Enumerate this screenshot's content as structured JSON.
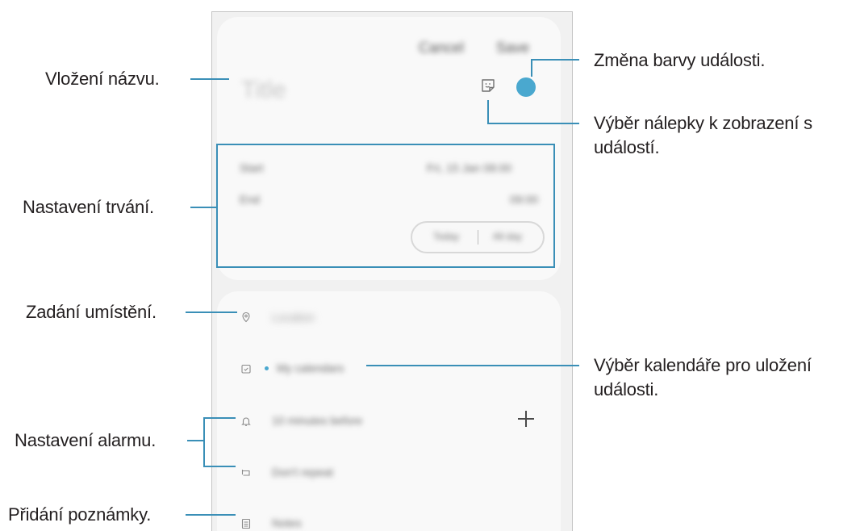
{
  "screen": {
    "header": {
      "cancel_label": "Cancel",
      "save_label": "Save"
    },
    "title_placeholder": "Title",
    "start_label": "Start",
    "start_value": "Fri, 15 Jan 08:00",
    "end_label": "End",
    "end_value": "09:00",
    "time_zone_left": "Today",
    "time_zone_right": "All day",
    "location_label": "Location",
    "calendar_label": "My calendars",
    "alarm_label": "10 minutes before",
    "repeat_label": "Don't repeat",
    "notes_label": "Notes"
  },
  "callouts": {
    "title": "Vložení názvu.",
    "duration": "Nastavení trvání.",
    "location": "Zadání umístění.",
    "alarm": "Nastavení alarmu.",
    "note": "Přidání poznámky.",
    "color": "Změna barvy události.",
    "sticker_line1": "Výběr nálepky k zobrazení s",
    "sticker_line2": "událostí.",
    "calendar_line1": "Výběr kalendáře pro uložení",
    "calendar_line2": "události."
  },
  "colors": {
    "accent": "#3a8fb7",
    "event_color": "#4aa8cf"
  }
}
